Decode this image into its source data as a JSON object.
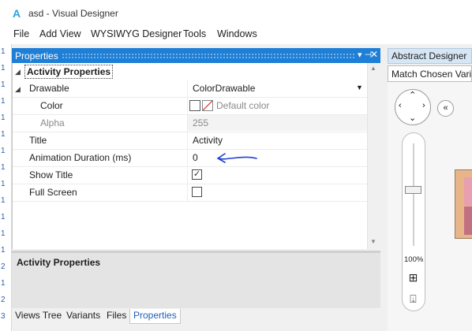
{
  "window": {
    "title": "asd - Visual Designer"
  },
  "menu": [
    "File",
    "Add View",
    "WYSIWYG Designer",
    "Tools",
    "Windows"
  ],
  "properties_panel": {
    "title": "Properties",
    "category": "Activity Properties",
    "rows": [
      {
        "name": "Drawable",
        "value": "ColorDrawable",
        "has_dropdown": true
      },
      {
        "name": "Color",
        "value": "Default color",
        "dimmed": true
      },
      {
        "name": "Alpha",
        "value": "255",
        "dimmed": true,
        "readonly": true
      },
      {
        "name": "Title",
        "value": "Activity"
      },
      {
        "name": "Animation Duration (ms)",
        "value": "0"
      },
      {
        "name": "Show Title",
        "value": "",
        "checked": true
      },
      {
        "name": "Full Screen",
        "value": "",
        "checked": false
      }
    ],
    "description_title": "Activity Properties"
  },
  "bottom_tabs": [
    {
      "label": "Views Tree",
      "active": false
    },
    {
      "label": "Variants",
      "active": false
    },
    {
      "label": "Files",
      "active": false
    },
    {
      "label": "Properties",
      "active": true
    }
  ],
  "right_pane": {
    "tab_label": "Abstract Designer",
    "match_field": "Match Chosen Varia",
    "zoom_label": "100%",
    "zoom_level_fraction": 0.55
  },
  "backdrop": {
    "line_numbers": [
      "1",
      "1",
      "1",
      "1",
      "1",
      "1",
      "1",
      "1",
      "1",
      "1",
      "1",
      "1",
      "1",
      "2",
      "1",
      "2",
      "3"
    ]
  },
  "colors": {
    "panel_header": "#1f7fd6",
    "active_tab_text": "#1f5fb8",
    "annotation_stroke": "#1f3fd6"
  },
  "icons": [
    "app-icon",
    "pin-icon",
    "close-icon",
    "expander-icon",
    "dropdown-arrow-icon",
    "nav-arrows-icon",
    "collapse-icon",
    "fit-icon",
    "export-icon"
  ]
}
